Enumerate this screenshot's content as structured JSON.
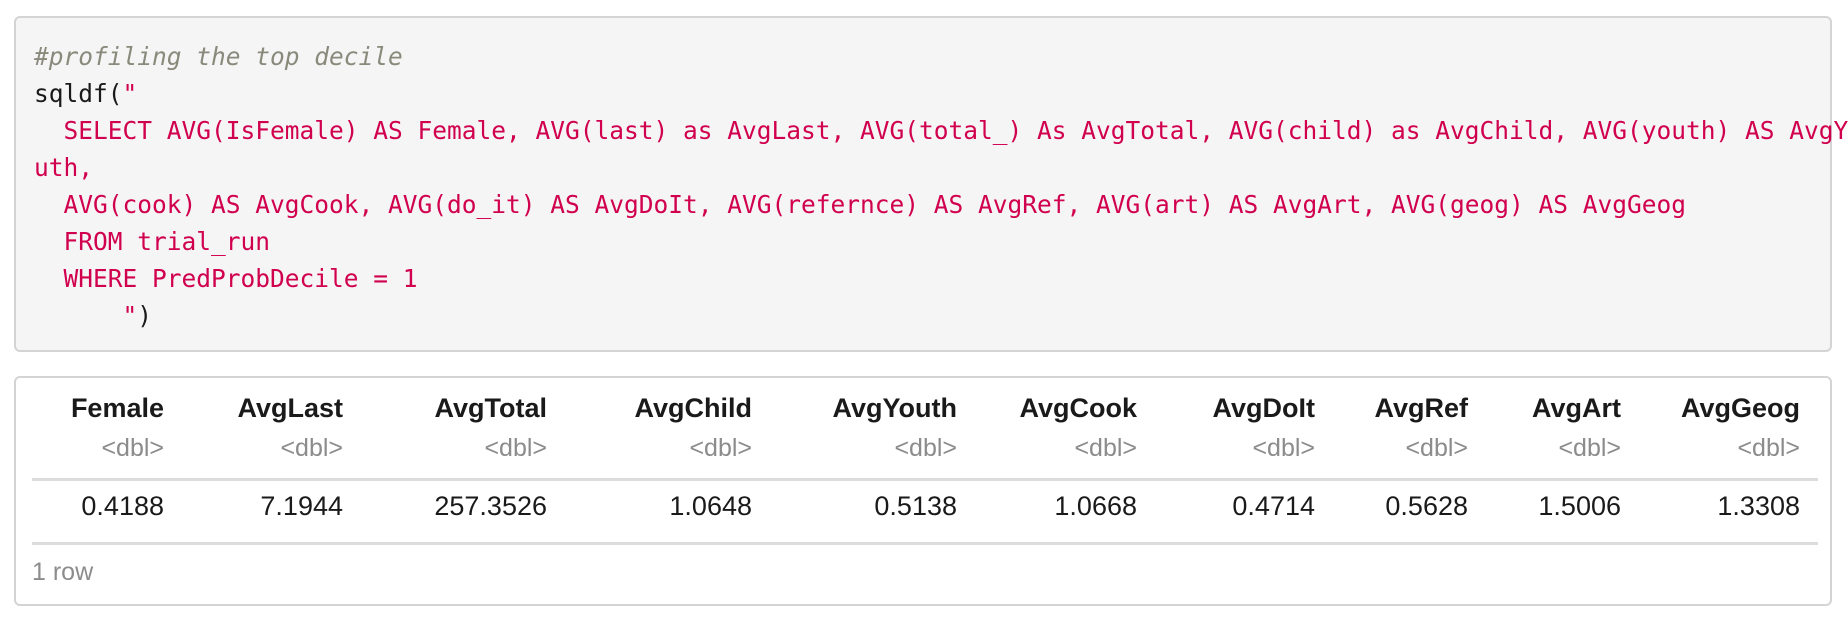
{
  "code": {
    "comment": "#profiling the top decile",
    "call_open": "sqldf(",
    "string_lines": [
      "\"",
      "  SELECT AVG(IsFemale) AS Female, AVG(last) as AvgLast, AVG(total_) As AvgTotal, AVG(child) as AvgChild, AVG(youth) AS AvgYo",
      "uth,",
      "  AVG(cook) AS AvgCook, AVG(do_it) AS AvgDoIt, AVG(refernce) AS AvgRef, AVG(art) AS AvgArt, AVG(geog) AS AvgGeog",
      "  FROM trial_run",
      "  WHERE PredProbDecile = 1",
      "      \""
    ],
    "call_close": ")"
  },
  "table": {
    "columns": [
      {
        "name": "Female",
        "type": "<dbl>"
      },
      {
        "name": "AvgLast",
        "type": "<dbl>"
      },
      {
        "name": "AvgTotal",
        "type": "<dbl>"
      },
      {
        "name": "AvgChild",
        "type": "<dbl>"
      },
      {
        "name": "AvgYouth",
        "type": "<dbl>"
      },
      {
        "name": "AvgCook",
        "type": "<dbl>"
      },
      {
        "name": "AvgDoIt",
        "type": "<dbl>"
      },
      {
        "name": "AvgRef",
        "type": "<dbl>"
      },
      {
        "name": "AvgArt",
        "type": "<dbl>"
      },
      {
        "name": "AvgGeog",
        "type": "<dbl>"
      }
    ],
    "rows": [
      [
        "0.4188",
        "7.1944",
        "257.3526",
        "1.0648",
        "0.5138",
        "1.0668",
        "0.4714",
        "0.5628",
        "1.5006",
        "1.3308"
      ]
    ],
    "footer": "1 row"
  },
  "colors": {
    "code_background": "#f5f5f5",
    "string": "#d1004e",
    "comment": "#8a8a7c",
    "type_label": "#8c8c8c"
  }
}
